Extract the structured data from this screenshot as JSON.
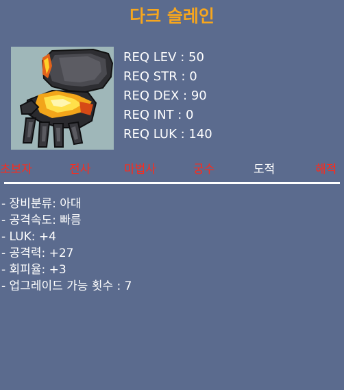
{
  "item": {
    "name": "다크 슬레인",
    "icon": "dark-glove-icon"
  },
  "requirements": [
    "REQ LEV : 50",
    "REQ STR : 0",
    "REQ DEX : 90",
    "REQ INT : 0",
    "REQ LUK : 140"
  ],
  "jobs": [
    {
      "label": "초보자",
      "allowed": false
    },
    {
      "label": "전사",
      "allowed": false
    },
    {
      "label": "마법사",
      "allowed": false
    },
    {
      "label": "궁수",
      "allowed": false
    },
    {
      "label": "도적",
      "allowed": true
    },
    {
      "label": "해적",
      "allowed": false
    }
  ],
  "stats": [
    "- 장비분류: 아대",
    "- 공격속도: 빠름",
    "- LUK: +4",
    "- 공격력: +27",
    "- 회피율: +3",
    "- 업그레이드 가능 횟수 : 7"
  ],
  "colors": {
    "background": "#5b6b8e",
    "title": "#f7a61d",
    "job_disabled": "#ff2a1a",
    "job_enabled": "#ffffff",
    "icon_frame": "#9fb7b9"
  }
}
